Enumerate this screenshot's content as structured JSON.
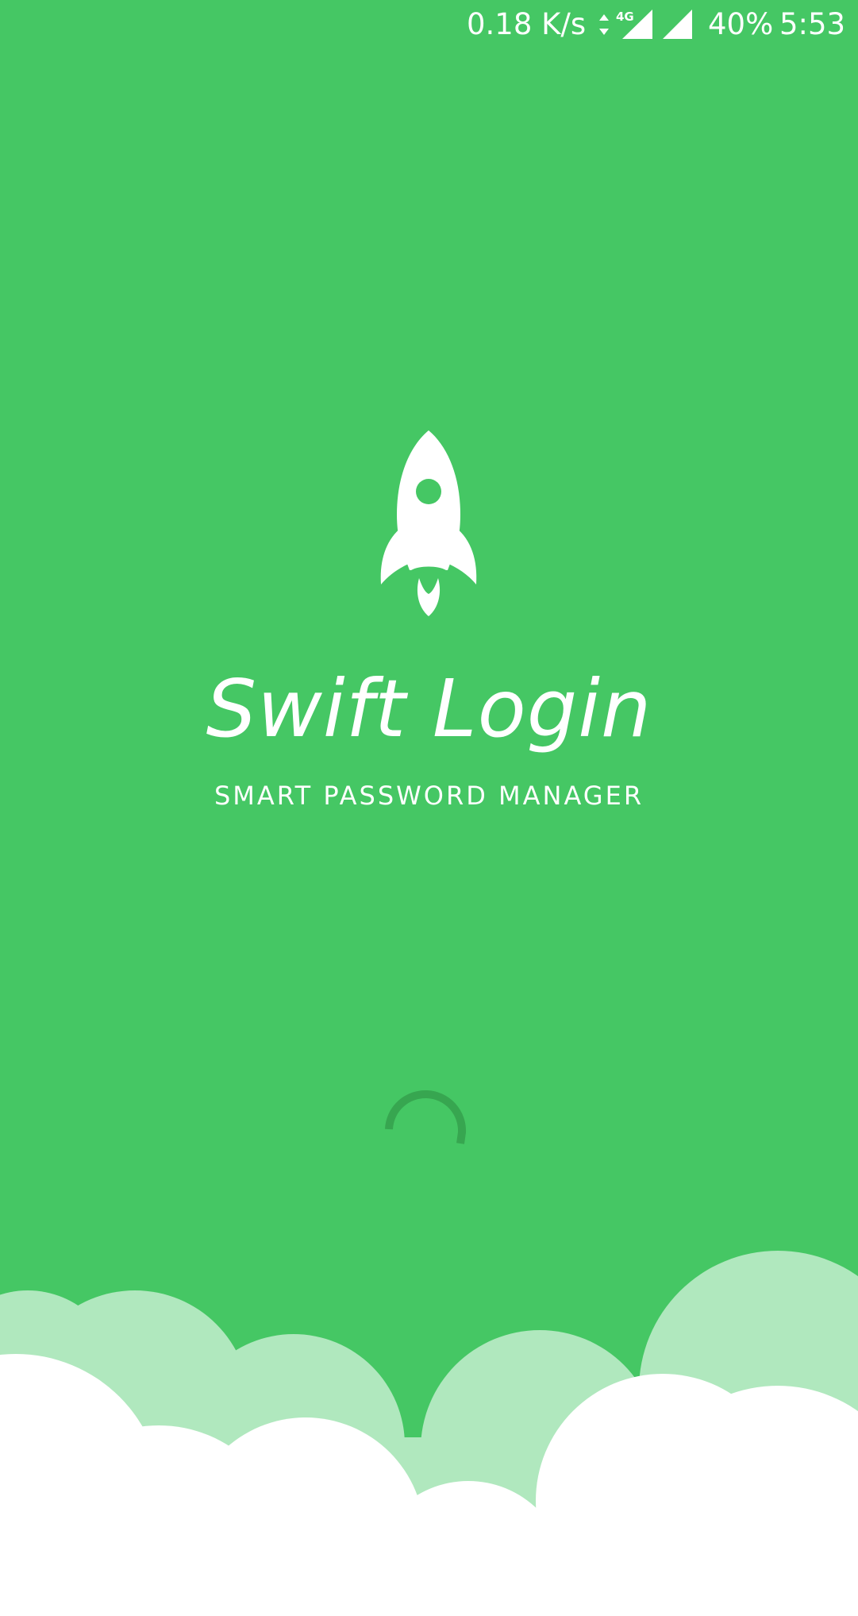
{
  "status_bar": {
    "net_speed": "0.18 K/s",
    "network_type": "4G",
    "battery": "40%",
    "time": "5:53",
    "icons": [
      "data-arrows-icon",
      "signal-4g-icon",
      "signal-icon"
    ]
  },
  "splash": {
    "logo_icon": "rocket-icon",
    "app_name": "Swift Login",
    "tagline": "SMART PASSWORD MANAGER",
    "loading_indicator": "spinner-icon"
  },
  "colors": {
    "background": "#45C764",
    "cloud_back": "#B0E8BE",
    "cloud_front": "#FFFFFF",
    "spinner": "#37A650"
  }
}
